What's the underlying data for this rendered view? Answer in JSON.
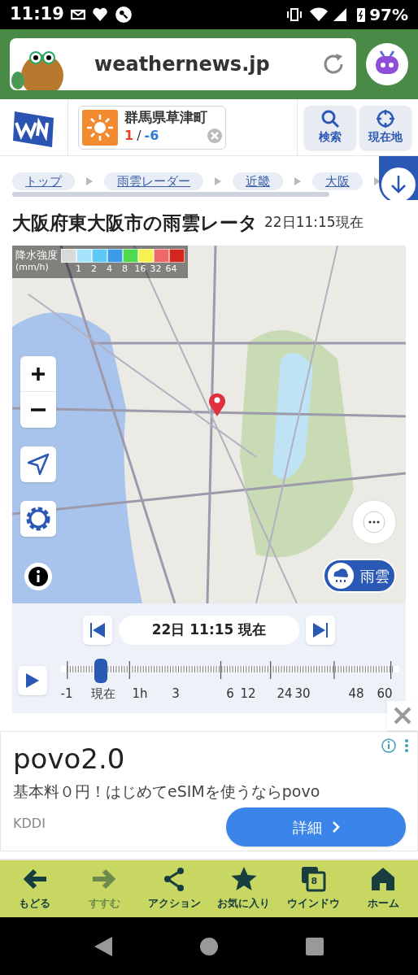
{
  "status_bar": {
    "time": "11:19",
    "battery": "97%"
  },
  "browser": {
    "url": "weathernews.jp"
  },
  "header": {
    "location": "群馬県草津町",
    "temp_high": "1",
    "separator": "/",
    "temp_low": "-6",
    "buttons": [
      {
        "kind": "search",
        "label": "検索"
      },
      {
        "kind": "locate",
        "label": "現在地"
      }
    ]
  },
  "breadcrumbs": [
    "トップ",
    "雨雲レーダー",
    "近畿",
    "大阪"
  ],
  "page_title": {
    "title": "大阪府東大阪市の雨雲レータ",
    "timestamp": "22日11:15現在"
  },
  "legend": {
    "title": "降水強度",
    "unit": "(mm/h)",
    "swatches": [
      {
        "color": "#d9d9d9"
      },
      {
        "color": "#a6e3fb"
      },
      {
        "color": "#5cc8f5"
      },
      {
        "color": "#3d9be9"
      },
      {
        "color": "#4fd94f"
      },
      {
        "color": "#f5f250"
      },
      {
        "color": "#ef6767"
      },
      {
        "color": "#d3271d"
      }
    ],
    "scale": [
      "1",
      "2",
      "4",
      "8",
      "16",
      "32",
      "64"
    ]
  },
  "map": {
    "layer_button": "雨雲"
  },
  "timeline": {
    "current": "22日 11:15 現在",
    "level": 0.1,
    "ticks": [
      "-1",
      "現在",
      "1h",
      "3",
      "6",
      "12",
      "24",
      "30",
      "48",
      "60"
    ]
  },
  "ad": {
    "title": "povo2.0",
    "text": "基本料０円！はじめてeSIMを使うならpovo",
    "advertiser": "KDDI",
    "button": "詳細"
  },
  "toolbar": [
    {
      "kind": "back",
      "label": "もどる",
      "disabled": false
    },
    {
      "kind": "forward",
      "label": "すすむ",
      "disabled": true
    },
    {
      "kind": "share",
      "label": "アクション",
      "disabled": false
    },
    {
      "kind": "star",
      "label": "お気に入り",
      "disabled": false
    },
    {
      "kind": "windows",
      "label": "ウインドウ",
      "count": "8",
      "disabled": false
    },
    {
      "kind": "home",
      "label": "ホーム",
      "disabled": false
    }
  ]
}
